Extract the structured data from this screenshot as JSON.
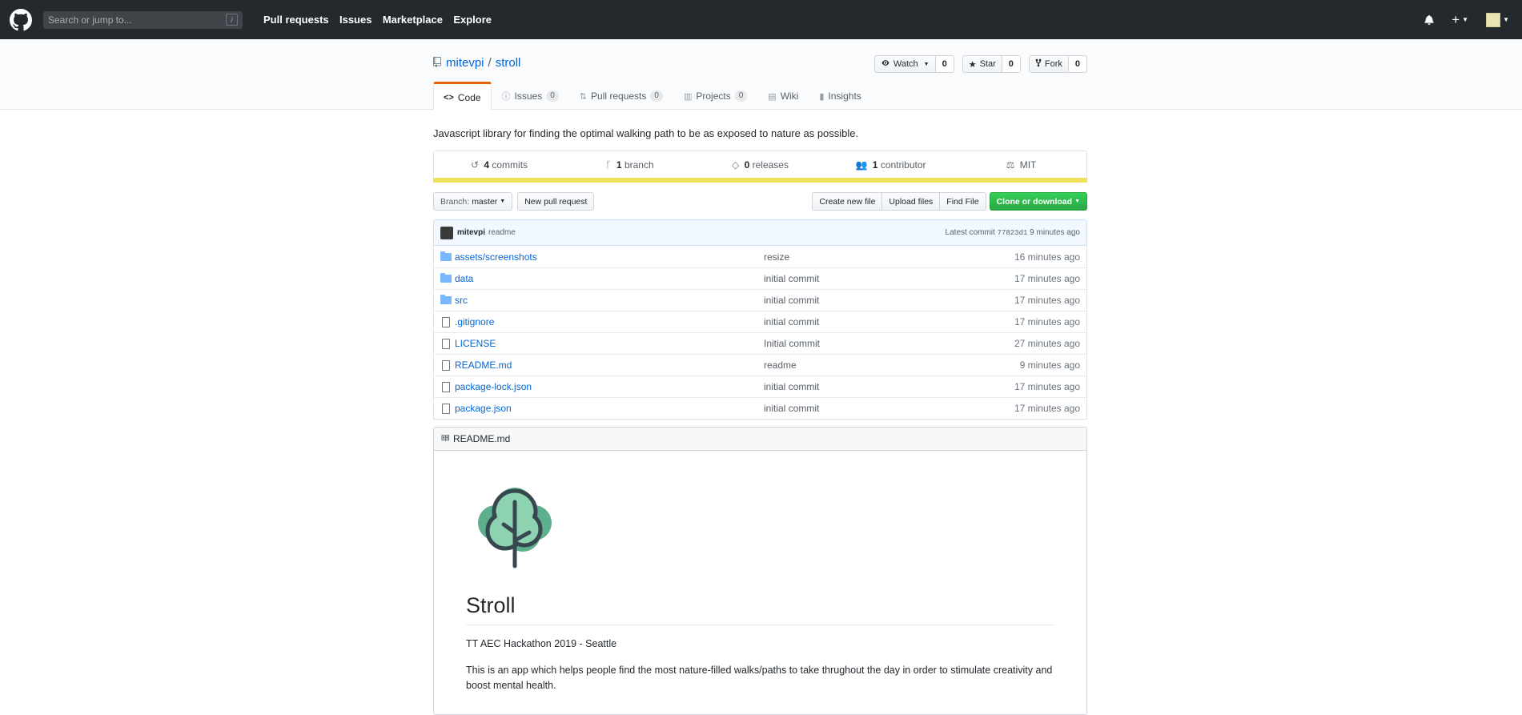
{
  "header": {
    "search_placeholder": "Search or jump to...",
    "search_shortcut": "/",
    "nav": [
      "Pull requests",
      "Issues",
      "Marketplace",
      "Explore"
    ],
    "plus_label": "+"
  },
  "repo": {
    "owner": "mitevpi",
    "separator": "/",
    "name": "stroll",
    "watch_label": "Watch",
    "watch_count": "0",
    "star_label": "Star",
    "star_count": "0",
    "fork_label": "Fork",
    "fork_count": "0"
  },
  "tabs": [
    {
      "label": "Code",
      "counter": ""
    },
    {
      "label": "Issues",
      "counter": "0"
    },
    {
      "label": "Pull requests",
      "counter": "0"
    },
    {
      "label": "Projects",
      "counter": "0"
    },
    {
      "label": "Wiki",
      "counter": ""
    },
    {
      "label": "Insights",
      "counter": ""
    }
  ],
  "description": "Javascript library for finding the optimal walking path to be as exposed to nature as possible.",
  "summary": {
    "commits_num": "4",
    "commits_label": "commits",
    "branch_num": "1",
    "branch_label": "branch",
    "releases_num": "0",
    "releases_label": "releases",
    "contributor_num": "1",
    "contributor_label": "contributor",
    "license": "MIT",
    "language_color": "#f1e05a"
  },
  "file_nav": {
    "branch_prefix": "Branch:",
    "branch_name": "master",
    "new_pr": "New pull request",
    "create_file": "Create new file",
    "upload": "Upload files",
    "find": "Find File",
    "clone": "Clone or download"
  },
  "latest_commit": {
    "author": "mitevpi",
    "message": "readme",
    "label": "Latest commit",
    "sha": "77823d1",
    "age": "9 minutes ago"
  },
  "files": [
    {
      "type": "dir",
      "prefix": "assets/",
      "name": "screenshots",
      "message": "resize",
      "age": "16 minutes ago"
    },
    {
      "type": "dir",
      "prefix": "",
      "name": "data",
      "message": "initial commit",
      "age": "17 minutes ago"
    },
    {
      "type": "dir",
      "prefix": "",
      "name": "src",
      "message": "initial commit",
      "age": "17 minutes ago"
    },
    {
      "type": "file",
      "prefix": "",
      "name": ".gitignore",
      "message": "initial commit",
      "age": "17 minutes ago"
    },
    {
      "type": "file",
      "prefix": "",
      "name": "LICENSE",
      "message": "Initial commit",
      "age": "27 minutes ago"
    },
    {
      "type": "file",
      "prefix": "",
      "name": "README.md",
      "message": "readme",
      "age": "9 minutes ago"
    },
    {
      "type": "file",
      "prefix": "",
      "name": "package-lock.json",
      "message": "initial commit",
      "age": "17 minutes ago"
    },
    {
      "type": "file",
      "prefix": "",
      "name": "package.json",
      "message": "initial commit",
      "age": "17 minutes ago"
    }
  ],
  "readme": {
    "filename": "README.md",
    "title": "Stroll",
    "subtitle": "TT AEC Hackathon 2019 - Seattle",
    "paragraph": "This is an app which helps people find the most nature-filled walks/paths to take thrughout the day in order to stimulate creativity and boost mental health."
  }
}
